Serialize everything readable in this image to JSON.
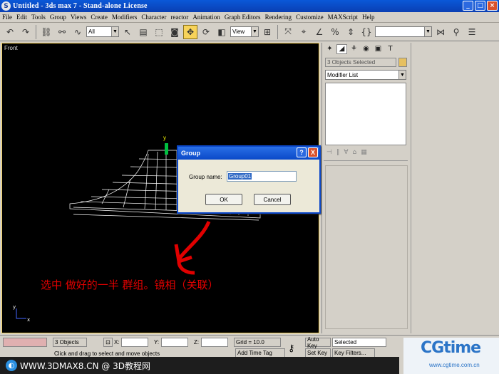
{
  "window": {
    "title": "Untitled - 3ds max 7  - Stand-alone License",
    "icon_letter": "S"
  },
  "menu": [
    "File",
    "Edit",
    "Tools",
    "Group",
    "Views",
    "Create",
    "Modifiers",
    "Character",
    "reactor",
    "Animation",
    "Graph Editors",
    "Rendering",
    "Customize",
    "MAXScript",
    "Help"
  ],
  "toolbar": {
    "selection_filter": "All",
    "ref_coord": "View",
    "named_selection": ""
  },
  "viewport": {
    "label": "Front",
    "axis_y": "y",
    "axis_x": "x"
  },
  "annotation": "选中  做好的一半   群组。镜相（关联）",
  "dialog": {
    "title": "Group",
    "help_button": "?",
    "close_button": "X",
    "name_label": "Group name:",
    "name_value": "Group01",
    "ok_label": "OK",
    "cancel_label": "Cancel"
  },
  "command_panel": {
    "selection_text": "3 Objects Selected",
    "modifier_list": "Modifier List",
    "object_color": "#e6c060"
  },
  "status": {
    "objects": "3 Objects",
    "x_label": "X:",
    "y_label": "Y:",
    "z_label": "Z:",
    "grid": "Grid = 10.0",
    "auto_key": "Auto Key",
    "key_mode": "Selected",
    "set_key": "Set Key",
    "key_filters": "Key Filters...",
    "prompt": "Click and drag to select and move objects",
    "add_time_tag": "Add Time Tag",
    "frame": "0"
  },
  "footer": {
    "text": "WWW.3DMAX8.CN @ 3D教程网",
    "cg_logo": "CGtime",
    "cg_url": "www.cgtime.com.cn"
  },
  "colors": {
    "title_bar": "#0a47c9",
    "annotation": "#e00000",
    "active_button": "#f7d35a"
  }
}
